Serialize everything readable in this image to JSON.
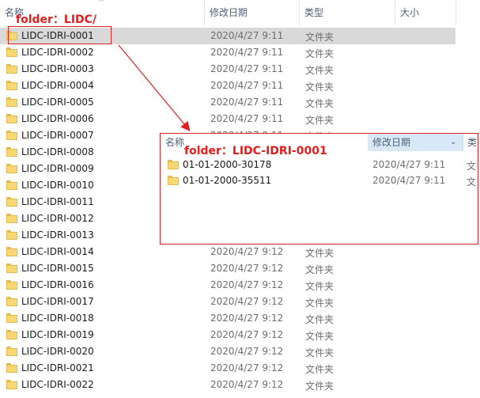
{
  "header": {
    "col_name": "名称",
    "col_date": "修改日期",
    "col_type": "类型",
    "col_size": "大小",
    "sort_icon": "chevron-up-icon"
  },
  "rows": [
    {
      "name": "LIDC-IDRI-0001",
      "date": "2020/4/27 9:11",
      "type": "文件夹",
      "selected": true
    },
    {
      "name": "LIDC-IDRI-0002",
      "date": "2020/4/27 9:11",
      "type": "文件夹"
    },
    {
      "name": "LIDC-IDRI-0003",
      "date": "2020/4/27 9:11",
      "type": "文件夹"
    },
    {
      "name": "LIDC-IDRI-0004",
      "date": "2020/4/27 9:11",
      "type": "文件夹"
    },
    {
      "name": "LIDC-IDRI-0005",
      "date": "2020/4/27 9:11",
      "type": "文件夹"
    },
    {
      "name": "LIDC-IDRI-0006",
      "date": "2020/4/27 9:11",
      "type": "文件夹"
    },
    {
      "name": "LIDC-IDRI-0007",
      "date": "2020/4/27 9:11",
      "type": "文件夹"
    },
    {
      "name": "LIDC-IDRI-0008",
      "date": "",
      "type": ""
    },
    {
      "name": "LIDC-IDRI-0009",
      "date": "",
      "type": ""
    },
    {
      "name": "LIDC-IDRI-0010",
      "date": "",
      "type": ""
    },
    {
      "name": "LIDC-IDRI-0011",
      "date": "",
      "type": ""
    },
    {
      "name": "LIDC-IDRI-0012",
      "date": "",
      "type": ""
    },
    {
      "name": "LIDC-IDRI-0013",
      "date": "",
      "type": ""
    },
    {
      "name": "LIDC-IDRI-0014",
      "date": "2020/4/27 9:12",
      "type": "文件夹"
    },
    {
      "name": "LIDC-IDRI-0015",
      "date": "2020/4/27 9:12",
      "type": "文件夹"
    },
    {
      "name": "LIDC-IDRI-0016",
      "date": "2020/4/27 9:12",
      "type": "文件夹"
    },
    {
      "name": "LIDC-IDRI-0017",
      "date": "2020/4/27 9:12",
      "type": "文件夹"
    },
    {
      "name": "LIDC-IDRI-0018",
      "date": "2020/4/27 9:12",
      "type": "文件夹"
    },
    {
      "name": "LIDC-IDRI-0019",
      "date": "2020/4/27 9:12",
      "type": "文件夹"
    },
    {
      "name": "LIDC-IDRI-0020",
      "date": "2020/4/27 9:12",
      "type": "文件夹"
    },
    {
      "name": "LIDC-IDRI-0021",
      "date": "2020/4/27 9:12",
      "type": "文件夹"
    },
    {
      "name": "LIDC-IDRI-0022",
      "date": "2020/4/27 9:12",
      "type": "文件夹"
    }
  ],
  "annotations": {
    "root_label": "folder：LIDC/",
    "sub_label": "folder：LIDC-IDRI-0001",
    "color": "#e31c1c"
  },
  "popup": {
    "col_name": "名称",
    "col_date": "修改日期",
    "col_type_partial": "类",
    "rows": [
      {
        "name": "01-01-2000-30178",
        "date": "2020/4/27 9:11",
        "type_partial": "文"
      },
      {
        "name": "01-01-2000-35511",
        "date": "2020/4/27 9:11",
        "type_partial": "文"
      }
    ]
  },
  "colors": {
    "folder": "#f8d775",
    "selected_row": "#d9d9d9",
    "header_text": "#4c607a",
    "sorted_header": "#d9e8f7"
  }
}
